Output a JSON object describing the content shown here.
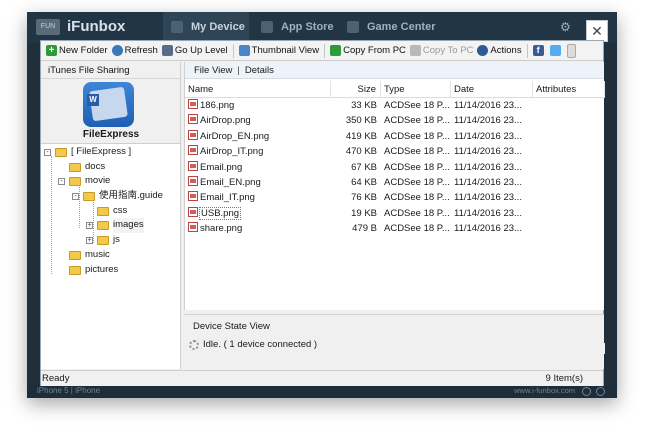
{
  "app": {
    "brand": "iFunbox",
    "logo_text": "FUN",
    "nav": [
      {
        "label": "My Device"
      },
      {
        "label": "App Store"
      },
      {
        "label": "Game Center"
      }
    ],
    "device_tag": "iPhone 5 | iPhone",
    "site": "www.i-funbox.com"
  },
  "toolbar": {
    "new_folder": "New Folder",
    "refresh": "Refresh",
    "go_up": "Go Up Level",
    "thumbnail": "Thumbnail View",
    "copy_from_pc": "Copy From PC",
    "copy_to_pc": "Copy To PC",
    "actions": "Actions",
    "facebook": "f"
  },
  "left": {
    "header": "iTunes File Sharing",
    "app_name": "FileExpress",
    "tree": [
      {
        "label": "[ FileExpress ]",
        "level": 0,
        "expander": "-"
      },
      {
        "label": "docs",
        "level": 1,
        "expander": ""
      },
      {
        "label": "movie",
        "level": 1,
        "expander": "-"
      },
      {
        "label": "使用指南.guide",
        "level": 2,
        "expander": "-"
      },
      {
        "label": "css",
        "level": 3,
        "expander": ""
      },
      {
        "label": "images",
        "level": 3,
        "expander": "+",
        "selected": true
      },
      {
        "label": "js",
        "level": 3,
        "expander": "+"
      },
      {
        "label": "music",
        "level": 1,
        "expander": ""
      },
      {
        "label": "pictures",
        "level": 1,
        "expander": ""
      }
    ]
  },
  "view_bar": {
    "file_view": "File View",
    "separator": "|",
    "details": "Details"
  },
  "table": {
    "columns": {
      "name": "Name",
      "size": "Size",
      "type": "Type",
      "date": "Date",
      "attributes": "Attributes"
    },
    "rows": [
      {
        "name": "186.png",
        "size": "33 KB",
        "type": "ACDSee 18 P...",
        "date": "11/14/2016  23..."
      },
      {
        "name": "AirDrop.png",
        "size": "350 KB",
        "type": "ACDSee 18 P...",
        "date": "11/14/2016  23..."
      },
      {
        "name": "AirDrop_EN.png",
        "size": "419 KB",
        "type": "ACDSee 18 P...",
        "date": "11/14/2016  23..."
      },
      {
        "name": "AirDrop_IT.png",
        "size": "470 KB",
        "type": "ACDSee 18 P...",
        "date": "11/14/2016  23..."
      },
      {
        "name": "Email.png",
        "size": "67 KB",
        "type": "ACDSee 18 P...",
        "date": "11/14/2016  23..."
      },
      {
        "name": "Email_EN.png",
        "size": "64 KB",
        "type": "ACDSee 18 P...",
        "date": "11/14/2016  23..."
      },
      {
        "name": "Email_IT.png",
        "size": "76 KB",
        "type": "ACDSee 18 P...",
        "date": "11/14/2016  23..."
      },
      {
        "name": "USB.png",
        "size": "19 KB",
        "type": "ACDSee 18 P...",
        "date": "11/14/2016  23..."
      },
      {
        "name": "share.png",
        "size": "479 B",
        "type": "ACDSee 18 P...",
        "date": "11/14/2016  23..."
      }
    ],
    "scroll_grip": "|||"
  },
  "device_state": {
    "title": "Device State View",
    "message": "Idle.  ( 1 device connected )"
  },
  "status": {
    "left": "Ready",
    "right": "9 Item(s)"
  },
  "colors": {
    "frame": "#1f2f3c",
    "accent": "#3c78b6"
  }
}
